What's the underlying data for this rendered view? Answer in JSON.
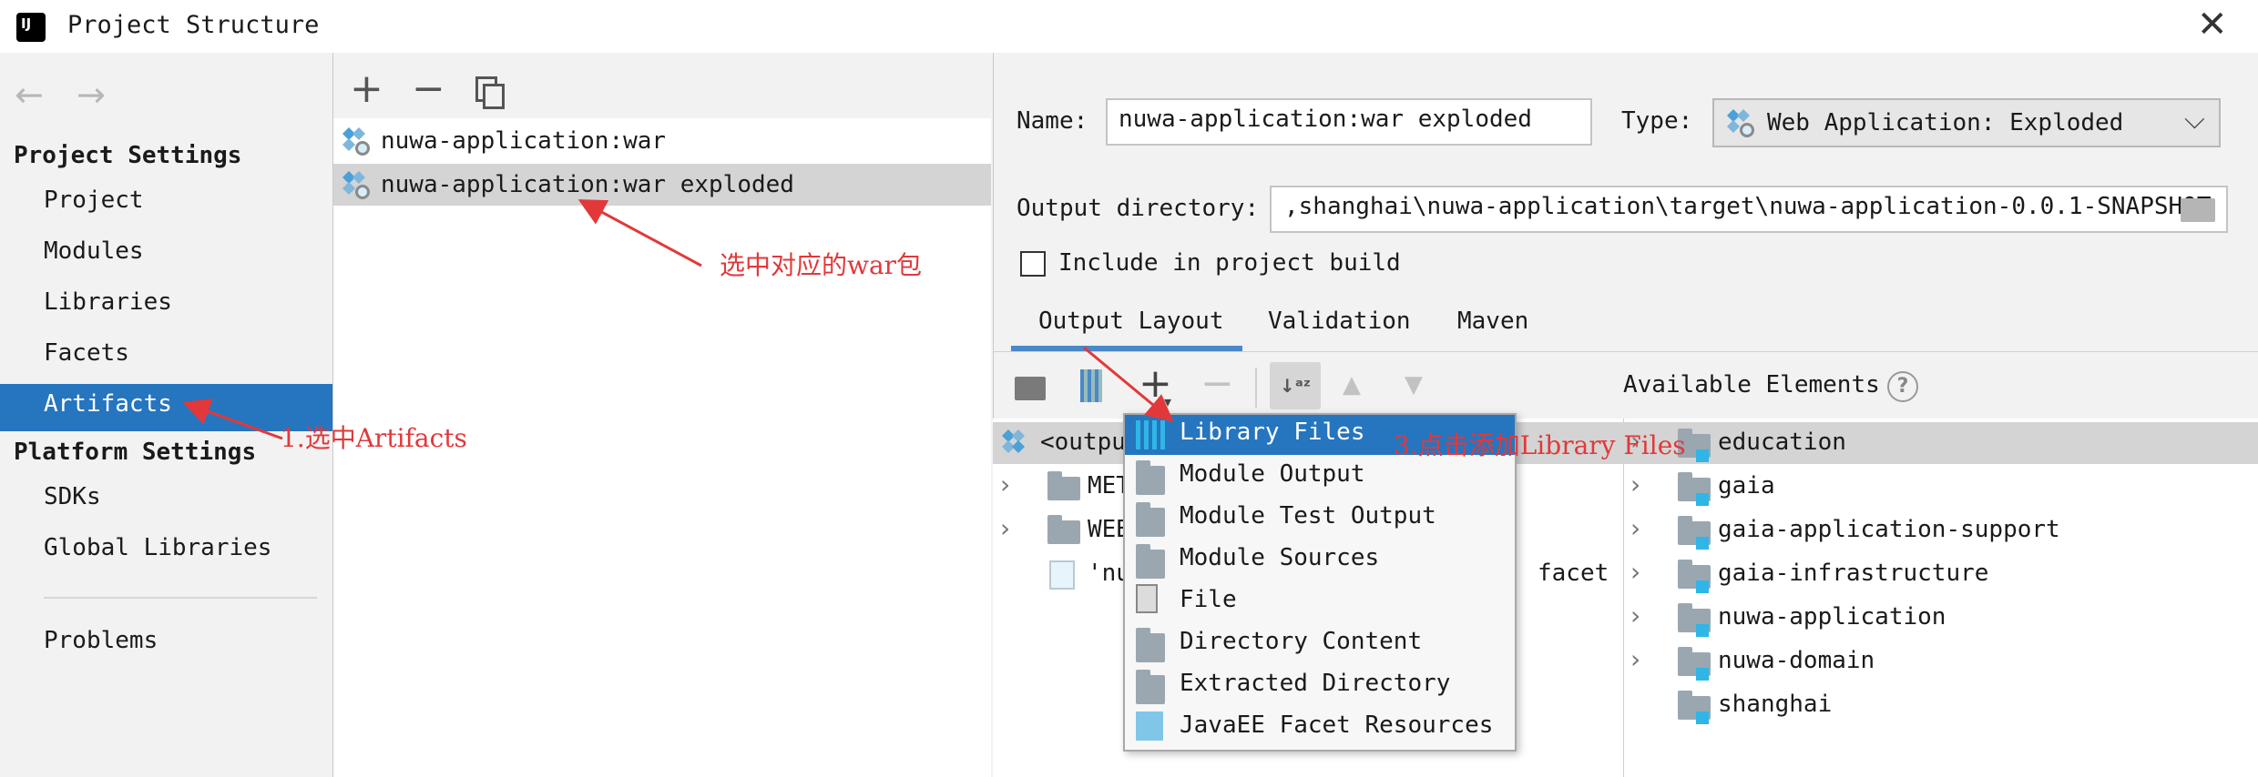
{
  "window": {
    "title": "Project Structure"
  },
  "sidebar": {
    "project_settings_label": "Project Settings",
    "project_items": [
      "Project",
      "Modules",
      "Libraries",
      "Facets",
      "Artifacts"
    ],
    "platform_settings_label": "Platform Settings",
    "platform_items": [
      "SDKs",
      "Global Libraries"
    ],
    "problems_label": "Problems",
    "selected": "Artifacts"
  },
  "artifacts": {
    "items": [
      "nuwa-application:war",
      "nuwa-application:war exploded"
    ],
    "selected": "nuwa-application:war exploded"
  },
  "form": {
    "name_label": "Name:",
    "name_value": "nuwa-application:war exploded",
    "type_label": "Type:",
    "type_value": "Web Application: Exploded",
    "output_dir_label": "Output directory:",
    "output_dir_value": ",shanghai\\nuwa-application\\target\\nuwa-application-0.0.1-SNAPSHOT",
    "include_label": "Include in project build",
    "include_checked": false
  },
  "tabs": [
    "Output Layout",
    "Validation",
    "Maven"
  ],
  "active_tab": "Output Layout",
  "available_elements_label": "Available Elements",
  "tree_left": {
    "root": "<outpu",
    "rows": [
      "META",
      "WEB",
      "'nu"
    ],
    "facet_text": "facet"
  },
  "tree_right": [
    "education",
    "gaia",
    "gaia-application-support",
    "gaia-infrastructure",
    "nuwa-application",
    "nuwa-domain",
    "shanghai"
  ],
  "menu": {
    "items": [
      "Library Files",
      "Module Output",
      "Module Test Output",
      "Module Sources",
      "File",
      "Directory Content",
      "Extracted Directory",
      "JavaEE Facet Resources"
    ],
    "selected": "Library Files"
  },
  "annotations": {
    "select_artifacts": "1.选中Artifacts",
    "select_war": "选中对应的war包",
    "add_library": "3.点击添加Library Files"
  },
  "colors": {
    "selection": "#2675bf",
    "annotation": "#e2383a",
    "row_selected": "#d4d4d4"
  }
}
